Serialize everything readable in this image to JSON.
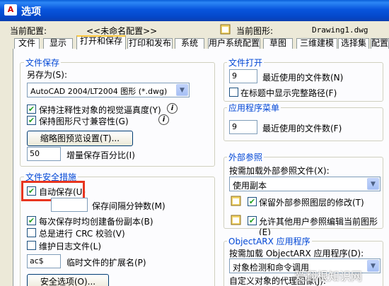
{
  "window": {
    "title": "选项"
  },
  "header": {
    "current_profile_label": "当前配置:",
    "current_profile_value": "<<未命名配置>>",
    "current_drawing_label": "当前图形:",
    "current_drawing_value": "Drawing1.dwg"
  },
  "tabs": [
    {
      "label": "文件"
    },
    {
      "label": "显示"
    },
    {
      "label": "打开和保存",
      "active": true
    },
    {
      "label": "打印和发布"
    },
    {
      "label": "系统"
    },
    {
      "label": "用户系统配置"
    },
    {
      "label": "草图"
    },
    {
      "label": "三维建模"
    },
    {
      "label": "选择集"
    },
    {
      "label": "配置"
    }
  ],
  "save": {
    "title": "文件保存",
    "save_as_label": "另存为(S):",
    "save_as_value": "AutoCAD 2004/LT2004 图形 (*.dwg)",
    "annot_label": "保持注释性对象的视觉逼真度(Y)",
    "annot_checked": true,
    "drawing_size_label": "保持图形尺寸兼容性(G)",
    "drawing_size_checked": true,
    "thumbnail_button": "缩略图预览设置(T)...",
    "incremental_value": "50",
    "incremental_label": "增量保存百分比(I)"
  },
  "safety": {
    "title": "文件安全措施",
    "autosave_label": "自动保存(U)",
    "autosave_checked": true,
    "autosave_minutes_label": "保存间隔分钟数(M)",
    "backup_label": "每次保存时均创建备份副本(B)",
    "backup_checked": true,
    "crc_label": "总是进行 CRC 校验(V)",
    "crc_checked": false,
    "log_label": "维护日志文件(L)",
    "log_checked": false,
    "ext_value": "ac$",
    "ext_label": "临时文件的扩展名(P)",
    "security_button": "安全选项(O)..."
  },
  "file_open": {
    "title": "文件打开",
    "recent_value": "9",
    "recent_label": "最近使用的文件数(N)",
    "fullpath_label": "在标题中显示完整路径(F)",
    "fullpath_checked": false
  },
  "app_menu": {
    "title": "应用程序菜单",
    "recent_value": "9",
    "recent_label": "最近使用的文件数(F)"
  },
  "xref": {
    "title": "外部参照",
    "demand_label": "按需加载外部参照文件(X):",
    "demand_value": "使用副本",
    "retain_label": "保留外部参照图层的修改(T)",
    "retain_checked": true,
    "allow_label": "允许其他用户参照编辑当前图形(E)",
    "allow_checked": true
  },
  "objectarx": {
    "title": "ObjectARX 应用程序",
    "demand_label": "按需加载 ObjectARX 应用程序(D):",
    "demand_value": "对象检测和命令调用",
    "proxy_label": "自定义对象的代理图像(J):"
  },
  "watermark": "爱翻根知识网"
}
